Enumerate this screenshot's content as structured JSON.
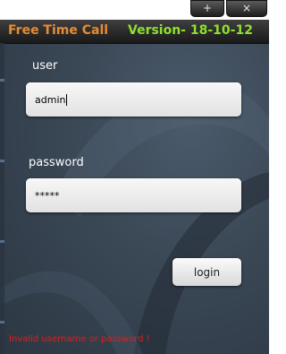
{
  "window_controls": {
    "minimize_icon": "plus-icon",
    "minimize_glyph": "+",
    "close_icon": "close-icon",
    "close_glyph": "×"
  },
  "header": {
    "title": "Free Time Call",
    "version": "Version- 18-10-12",
    "title_color": "#e88b35",
    "version_color": "#8ee030"
  },
  "form": {
    "user_label": "user",
    "user_value": "admin",
    "password_label": "password",
    "password_value": "*****",
    "login_label": "login"
  },
  "status": {
    "error": "Invalid username or password !",
    "error_color": "#e21d1d"
  }
}
